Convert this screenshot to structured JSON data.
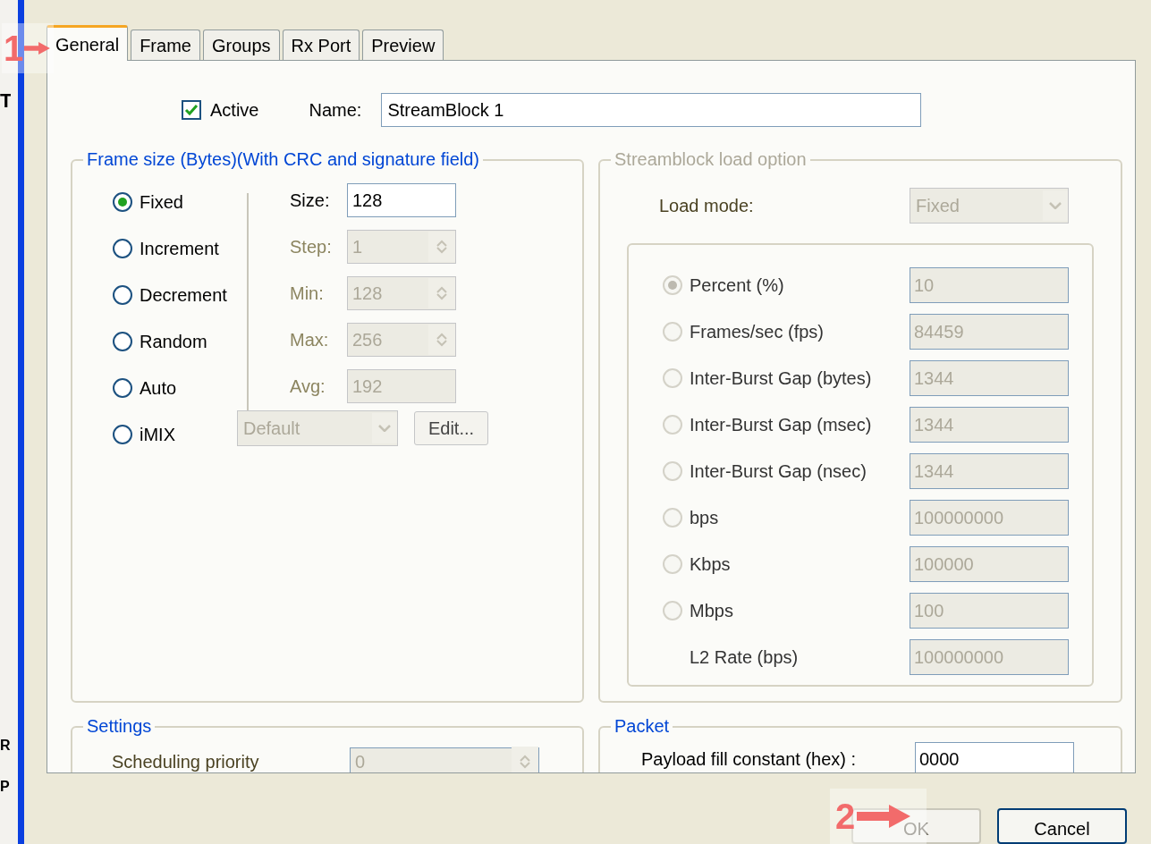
{
  "edge_fragments": [
    "T",
    "R",
    "P"
  ],
  "tabs": [
    {
      "label": "General",
      "selected": true
    },
    {
      "label": "Frame",
      "selected": false
    },
    {
      "label": "Groups",
      "selected": false
    },
    {
      "label": "Rx Port",
      "selected": false
    },
    {
      "label": "Preview",
      "selected": false
    }
  ],
  "general": {
    "active": {
      "label": "Active",
      "checked": true
    },
    "name_label": "Name:",
    "name_value": "StreamBlock 1"
  },
  "frame_size": {
    "title": "Frame size (Bytes)(With CRC and signature field)",
    "modes": [
      {
        "label": "Fixed",
        "selected": true
      },
      {
        "label": "Increment",
        "selected": false
      },
      {
        "label": "Decrement",
        "selected": false
      },
      {
        "label": "Random",
        "selected": false
      },
      {
        "label": "Auto",
        "selected": false
      },
      {
        "label": "iMIX",
        "selected": false
      }
    ],
    "fields": [
      {
        "label": "Size:",
        "value": "128",
        "disabled": false,
        "spinner": false
      },
      {
        "label": "Step:",
        "value": "1",
        "disabled": true,
        "spinner": true
      },
      {
        "label": "Min:",
        "value": "128",
        "disabled": true,
        "spinner": true
      },
      {
        "label": "Max:",
        "value": "256",
        "disabled": true,
        "spinner": true
      },
      {
        "label": "Avg:",
        "value": "192",
        "disabled": true,
        "spinner": false
      }
    ],
    "imix_value": "Default",
    "edit_button": "Edit..."
  },
  "load_option": {
    "title": "Streamblock load option",
    "load_mode_label": "Load mode:",
    "load_mode_value": "Fixed",
    "rates": [
      {
        "kind": "radio",
        "label": "Percent (%)",
        "value": "10",
        "selected": true
      },
      {
        "kind": "radio",
        "label": "Frames/sec (fps)",
        "value": "84459",
        "selected": false
      },
      {
        "kind": "radio",
        "label": "Inter-Burst Gap (bytes)",
        "value": "1344",
        "selected": false
      },
      {
        "kind": "radio",
        "label": "Inter-Burst Gap (msec)",
        "value": "1344",
        "selected": false
      },
      {
        "kind": "radio",
        "label": "Inter-Burst Gap (nsec)",
        "value": "1344",
        "selected": false
      },
      {
        "kind": "radio",
        "label": "bps",
        "value": "100000000",
        "selected": false
      },
      {
        "kind": "radio",
        "label": "Kbps",
        "value": "100000",
        "selected": false
      },
      {
        "kind": "radio",
        "label": "Mbps",
        "value": "100",
        "selected": false
      },
      {
        "kind": "plain",
        "label": "L2 Rate (bps)",
        "value": "100000000"
      }
    ]
  },
  "settings": {
    "title": "Settings",
    "scheduling_label": "Scheduling priority",
    "scheduling_value": "0"
  },
  "packet": {
    "title": "Packet",
    "payload_label": "Payload fill constant (hex) :",
    "payload_value": "0000"
  },
  "buttons": [
    {
      "label": "OK",
      "disabled": true
    },
    {
      "label": "Cancel",
      "disabled": false
    }
  ],
  "annotations": [
    "1",
    "2"
  ]
}
